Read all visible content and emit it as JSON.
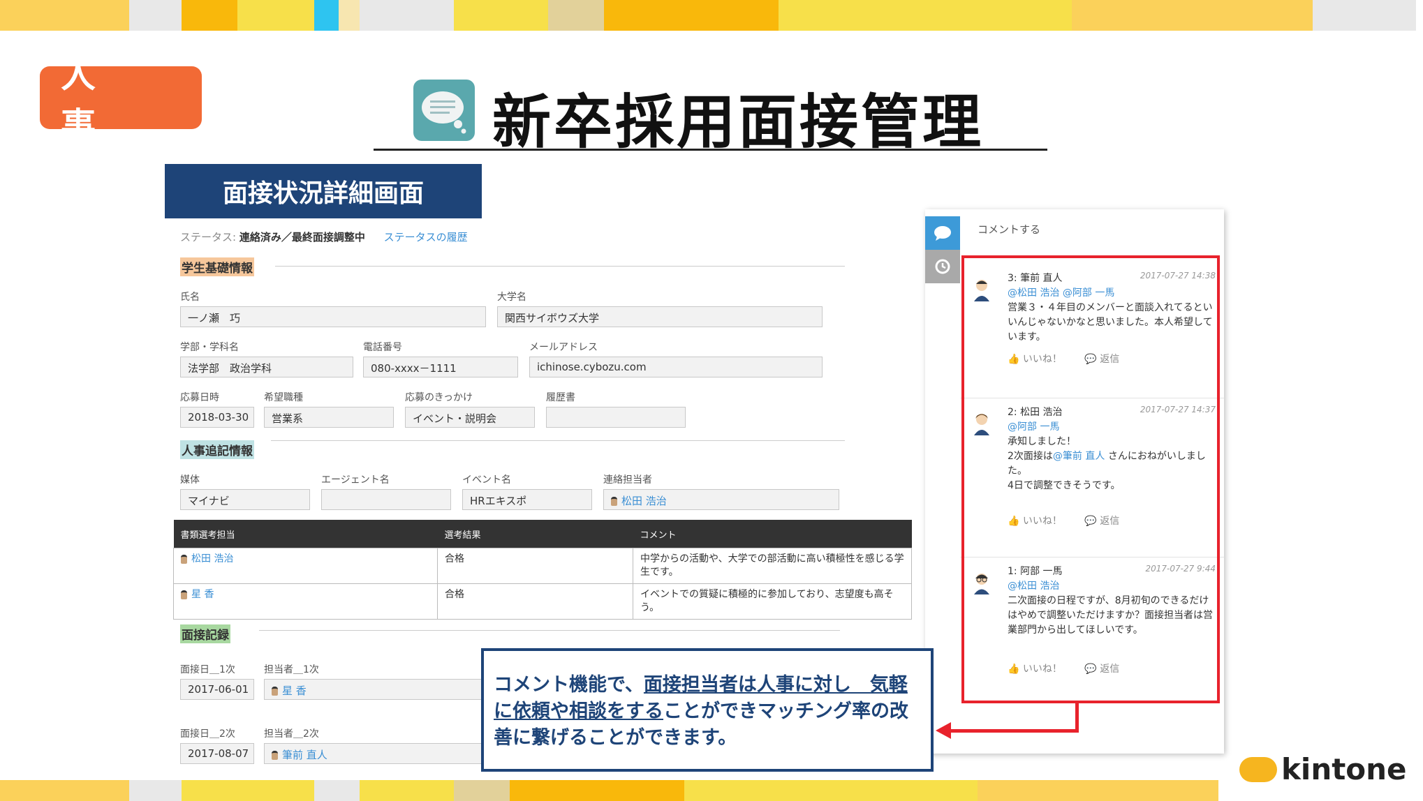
{
  "colors": {
    "accent_orange": "#f26a35",
    "navy": "#1e4478",
    "red": "#e8222c",
    "link": "#3b8fd4",
    "teal_icon": "#5aa8ad"
  },
  "badge": "人 事",
  "title": "新卒採用面接管理",
  "screen_label": "面接状況詳細画面",
  "status": {
    "prefix": "ステータス:",
    "value": "連絡済み／最終面接調整中",
    "history_link": "ステータスの履歴"
  },
  "sections": {
    "student": "学生基礎情報",
    "hr": "人事追記情報",
    "interview": "面接記録"
  },
  "fields": {
    "name": {
      "label": "氏名",
      "value": "一ノ瀬　巧"
    },
    "university": {
      "label": "大学名",
      "value": "関西サイボウズ大学"
    },
    "faculty": {
      "label": "学部・学科名",
      "value": "法学部　政治学科"
    },
    "phone": {
      "label": "電話番号",
      "value": "080-xxxx－1111"
    },
    "email": {
      "label": "メールアドレス",
      "value": "ichinose.cybozu.com"
    },
    "apply_date": {
      "label": "応募日時",
      "value": "2018-03-30"
    },
    "job_type": {
      "label": "希望職種",
      "value": "営業系"
    },
    "trigger": {
      "label": "応募のきっかけ",
      "value": "イベント・説明会"
    },
    "resume": {
      "label": "履歴書",
      "value": ""
    },
    "media": {
      "label": "媒体",
      "value": "マイナビ"
    },
    "agent": {
      "label": "エージェント名",
      "value": ""
    },
    "event": {
      "label": "イベント名",
      "value": "HRエキスポ"
    },
    "contact": {
      "label": "連絡担当者",
      "value": "松田 浩治"
    },
    "date1": {
      "label": "面接日＿1次",
      "value": "2017-06-01"
    },
    "person1": {
      "label": "担当者＿1次",
      "value": "星 香"
    },
    "date2": {
      "label": "面接日＿2次",
      "value": "2017-08-07"
    },
    "person2": {
      "label": "担当者＿2次",
      "value": "筆前 直人"
    }
  },
  "table": {
    "headers": [
      "書類選考担当",
      "選考結果",
      "コメント"
    ],
    "rows": [
      {
        "person": "松田 浩治",
        "result": "合格",
        "comment": "中学からの活動や、大学での部活動に高い積極性を感じる学生です。"
      },
      {
        "person": "星 香",
        "result": "合格",
        "comment": "イベントでの質疑に積極的に参加しており、志望度も高そう。"
      }
    ]
  },
  "comments_panel": {
    "action": "コメントする",
    "like": "いいね！",
    "reply": "返信",
    "items": [
      {
        "head": "3: 筆前 直人",
        "time": "2017-07-27 14:38",
        "mention": "@松田 浩治 @阿部 一馬",
        "body": "営業３・４年目のメンバーと面談入れてるといいんじゃないかなと思いました。本人希望しています。"
      },
      {
        "head": "2: 松田 浩治",
        "time": "2017-07-27 14:37",
        "mention": "@阿部 一馬",
        "body_1": "承知しました！",
        "body_2a": "2次面接は",
        "body_2m": "@筆前 直人",
        "body_2b": " さんにおねがいしました。",
        "body_3": "4日で調整できそうです。"
      },
      {
        "head": "1: 阿部 一馬",
        "time": "2017-07-27 9:44",
        "mention": "@松田 浩治",
        "body": "二次面接の日程ですが、8月初旬のできるだけはやめで調整いただけますか？面接担当者は営業部門から出してほしいです。"
      }
    ]
  },
  "callout": {
    "p1": "コメント機能で、",
    "u1": "面接担当者は人事に対し　気軽に依頼や相談をする",
    "p2": "ことができマッチング率の改善に繋げることができます。"
  },
  "brand": "kintone"
}
